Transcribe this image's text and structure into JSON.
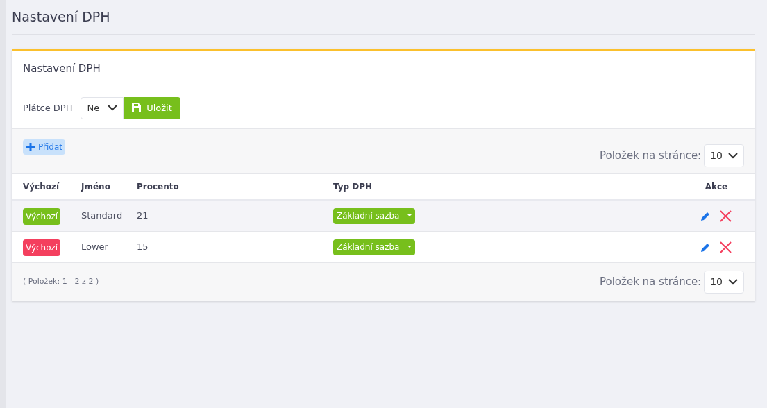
{
  "page_title": "Nastavení DPH",
  "card": {
    "title": "Nastavení DPH",
    "vat_payer": {
      "label": "Plátce DPH",
      "value": "Ne",
      "save_button": "Uložit"
    },
    "add_button": "Přidat",
    "page_size_top": {
      "label": "Položek na stránce:",
      "value": "10"
    },
    "table": {
      "columns": [
        "Výchozí",
        "Jméno",
        "Procento",
        "Typ DPH",
        "Akce"
      ],
      "rows": [
        {
          "default_badge": "Výchozí",
          "is_default": true,
          "name": "Standard",
          "percent": "21",
          "type": "Základní sazba"
        },
        {
          "default_badge": "Výchozí",
          "is_default": false,
          "name": "Lower",
          "percent": "15",
          "type": "Základní sazba"
        }
      ]
    },
    "summary": "( Položek: 1 - 2 z 2 )",
    "page_size_bottom": {
      "label": "Položek na stránce:",
      "value": "10"
    }
  }
}
